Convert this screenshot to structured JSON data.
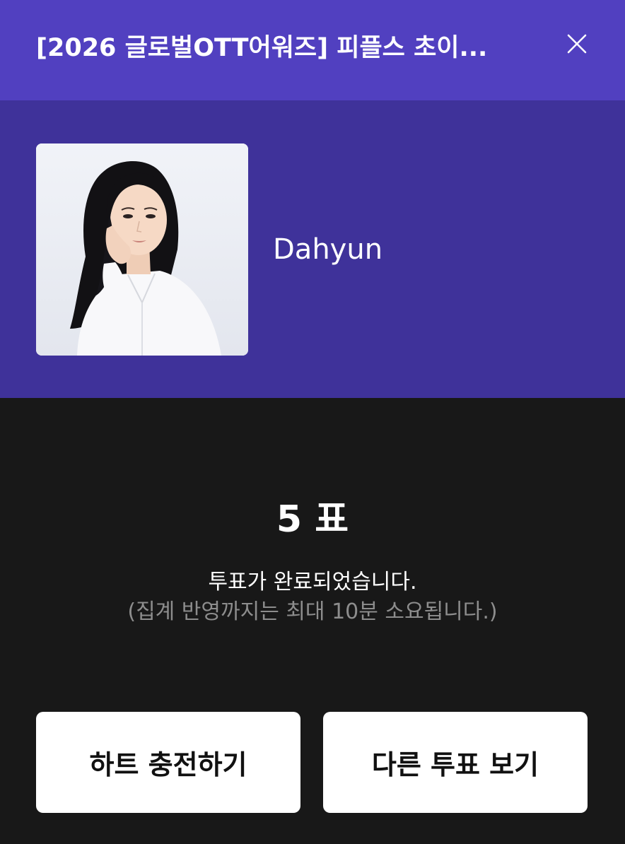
{
  "header": {
    "title": "[2026 글로벌OTT어워즈] 피플스 초이...",
    "close_icon": "close-icon"
  },
  "candidate": {
    "name": "Dahyun",
    "photo_icon": "candidate-photo"
  },
  "result": {
    "votes": "5 표",
    "message": "투표가 완료되었습니다.",
    "sub_message": "(집계 반영까지는 최대 10분 소요됩니다.)"
  },
  "buttons": {
    "charge_label": "하트 충전하기",
    "other_vote_label": "다른 투표 보기"
  },
  "colors": {
    "header_bg": "#5140c0",
    "candidate_bg": "#3f329a",
    "page_bg": "#181818",
    "sub_text": "#8d8d8d"
  }
}
